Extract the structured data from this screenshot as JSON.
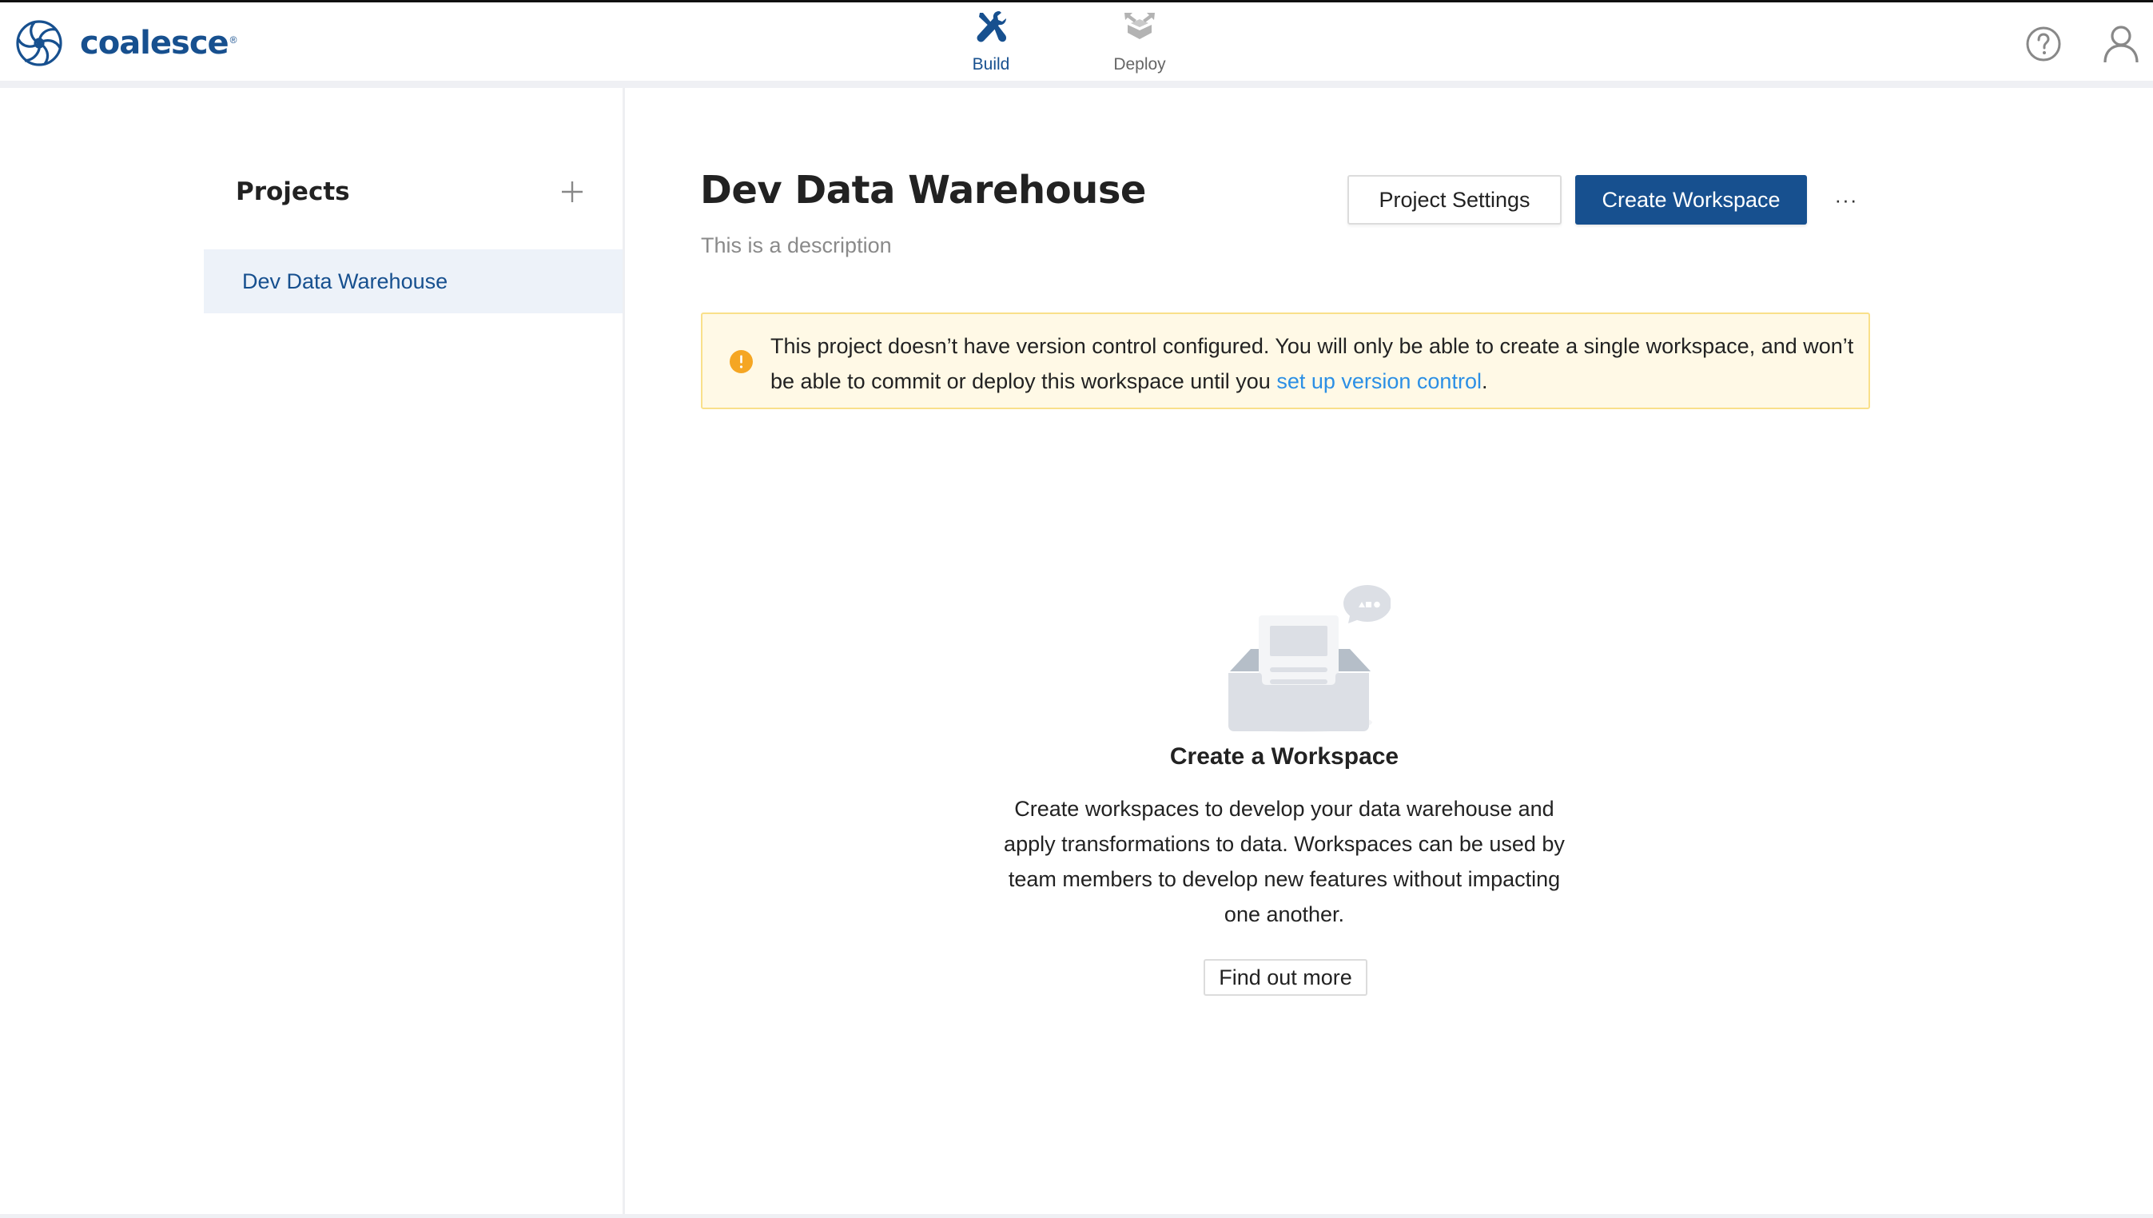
{
  "app": {
    "brand": "coalesce",
    "brand_mark": "®"
  },
  "nav": {
    "items": [
      {
        "label": "Build",
        "icon": "wrench-screwdriver-icon",
        "active": true
      },
      {
        "label": "Deploy",
        "icon": "deploy-box-icon",
        "active": false
      }
    ]
  },
  "header_actions": {
    "help_icon": "help-circle-icon",
    "user_icon": "user-icon"
  },
  "sidebar": {
    "title": "Projects",
    "add_icon": "plus-icon",
    "projects": [
      {
        "label": "Dev Data Warehouse",
        "selected": true
      }
    ]
  },
  "main": {
    "title": "Dev Data Warehouse",
    "description": "This is a description",
    "buttons": {
      "settings": "Project Settings",
      "create": "Create Workspace",
      "more": "···"
    },
    "banner": {
      "icon": "warning-icon",
      "text": "This project doesn’t have version control configured. You will only be able to create a single workspace, and won’t be able to commit or deploy this workspace until you ",
      "link": "set up version control",
      "suffix": "."
    },
    "empty_state": {
      "illustration": "inbox-document-icon",
      "title": "Create a Workspace",
      "body": "Create workspaces to develop your data warehouse and apply transformations to data. Workspaces can be used by team members to develop new features without impacting one another.",
      "button": "Find out more"
    }
  },
  "colors": {
    "brand": "#17508f",
    "warning": "#f5a623",
    "banner_bg": "#fff9e6",
    "banner_border": "#f9e08a",
    "link": "#2b8fe5",
    "selected_bg": "#edf2f9"
  }
}
